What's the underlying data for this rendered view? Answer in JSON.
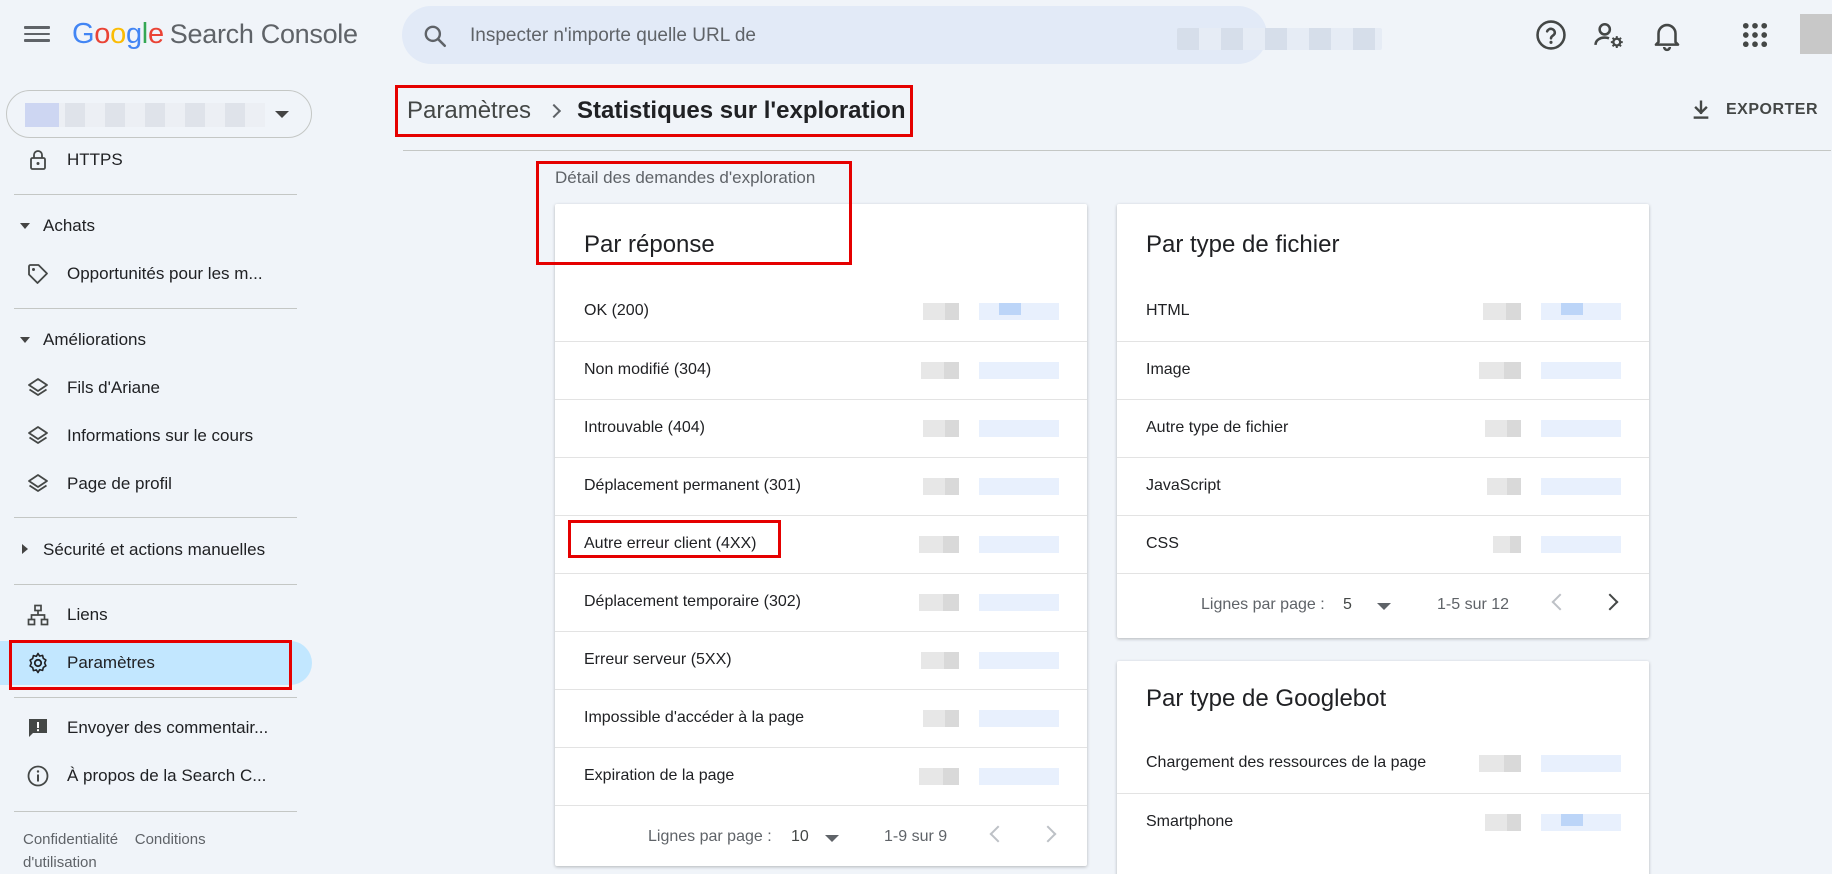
{
  "header": {
    "logo_letters": [
      "G",
      "o",
      "o",
      "g",
      "l",
      "e"
    ],
    "product": "Search Console",
    "search_placeholder": "Inspecter n'importe quelle URL de"
  },
  "sidebar": {
    "https": "HTTPS",
    "section_achats": "Achats",
    "opportunites": "Opportunités pour les m...",
    "section_ameliorations": "Améliorations",
    "fils_ariane": "Fils d'Ariane",
    "infos_cours": "Informations sur le cours",
    "page_profil": "Page de profil",
    "section_securite": "Sécurité et actions manuelles",
    "liens": "Liens",
    "parametres": "Paramètres",
    "commentaires": "Envoyer des commentair...",
    "a_propos": "À propos de la Search C...",
    "footer_confidentialite": "Confidentialité",
    "footer_conditions": "Conditions",
    "footer_utilisation": "d'utilisation"
  },
  "breadcrumb": {
    "parent": "Paramètres",
    "current": "Statistiques sur l'exploration"
  },
  "export_label": "EXPORTER",
  "section_title": "Détail des demandes d'exploration",
  "card_response": {
    "title": "Par réponse",
    "rows": [
      "OK (200)",
      "Non modifié (304)",
      "Introuvable (404)",
      "Déplacement permanent (301)",
      "Autre erreur client (4XX)",
      "Déplacement temporaire (302)",
      "Erreur serveur (5XX)",
      "Impossible d'accéder à la page",
      "Expiration de la page"
    ],
    "pager_label": "Lignes par page :",
    "pager_value": "10",
    "pager_range": "1-9 sur 9"
  },
  "card_filetype": {
    "title": "Par type de fichier",
    "rows": [
      "HTML",
      "Image",
      "Autre type de fichier",
      "JavaScript",
      "CSS"
    ],
    "pager_label": "Lignes par page :",
    "pager_value": "5",
    "pager_range": "1-5 sur 12"
  },
  "card_googlebot": {
    "title": "Par type de Googlebot",
    "rows": [
      "Chargement des ressources de la page",
      "Smartphone"
    ]
  }
}
